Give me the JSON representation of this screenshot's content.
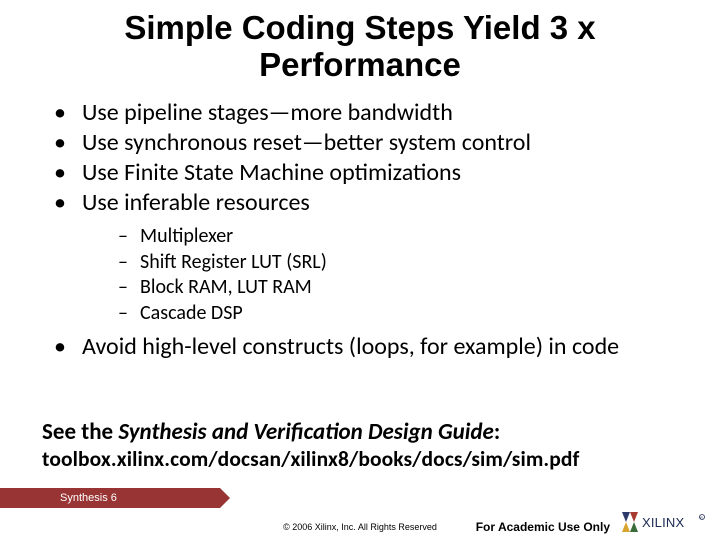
{
  "title": "Simple Coding Steps Yield 3 x Performance",
  "bullets": {
    "b0": "Use pipeline stages—more bandwidth",
    "b1": "Use synchronous reset—better system control",
    "b2": "Use Finite State Machine optimizations",
    "b3": "Use inferable resources",
    "sub": {
      "s0": "Multiplexer",
      "s1": "Shift Register LUT (SRL)",
      "s2": "Block RAM, LUT RAM",
      "s3": "Cascade DSP"
    },
    "b4": "Avoid high-level constructs (loops, for example) in code"
  },
  "guide": {
    "prefix": "See the ",
    "title": "Synthesis and Verification Design Guide",
    "suffix": ":",
    "url": "toolbox.xilinx.com/docsan/xilinx8/books/docs/sim/sim.pdf"
  },
  "footer": {
    "section": "Synthesis  6",
    "copyright": "© 2006 Xilinx, Inc. All Rights Reserved",
    "academic": "For Academic Use Only",
    "logo_text": "XILINX"
  }
}
